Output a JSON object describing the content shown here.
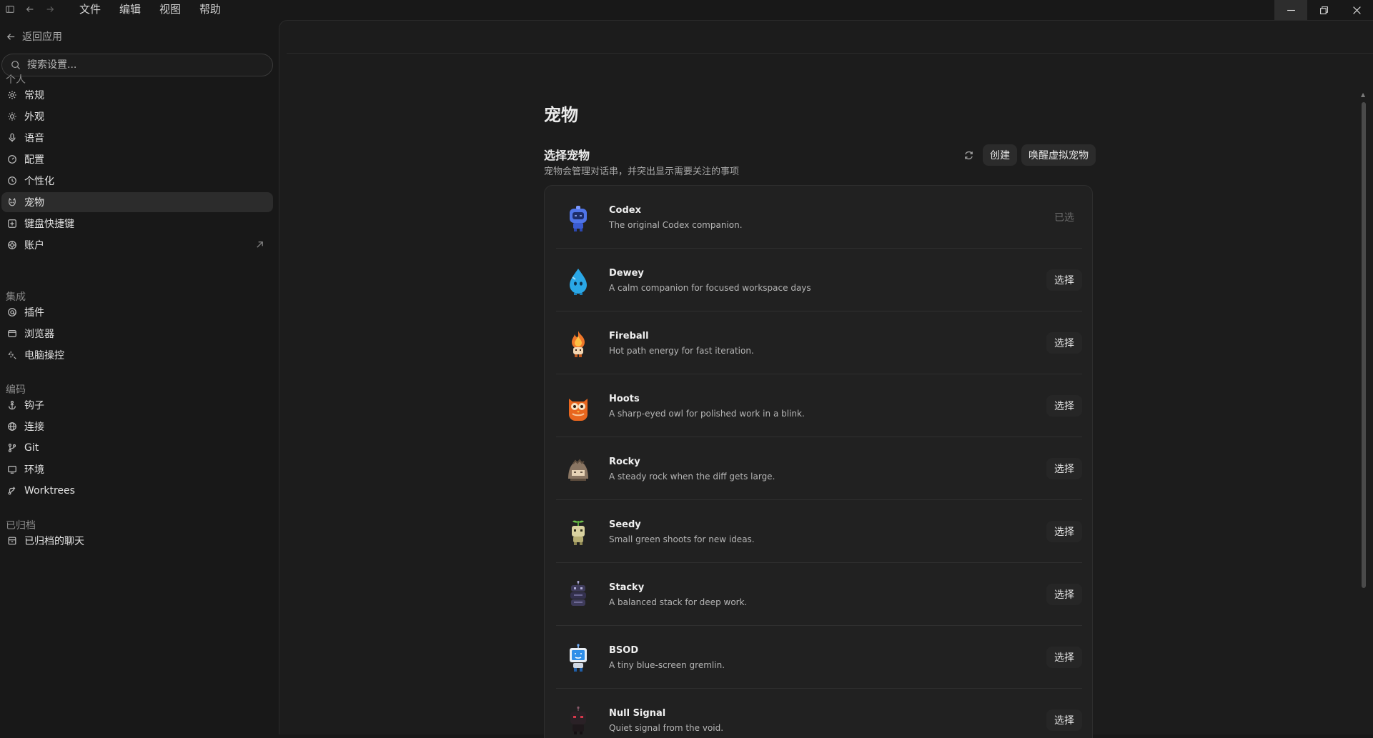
{
  "titlebar": {
    "menu": [
      "文件",
      "编辑",
      "视图",
      "帮助"
    ]
  },
  "sidebar": {
    "back_label": "返回应用",
    "search_placeholder": "搜索设置...",
    "sections": {
      "personal": "个人",
      "integrations": "集成",
      "coding": "编码",
      "archived": "已归档"
    },
    "personal_items": [
      {
        "label": "常规",
        "icon": "gear-icon"
      },
      {
        "label": "外观",
        "icon": "sun-icon"
      },
      {
        "label": "语音",
        "icon": "mic-icon"
      },
      {
        "label": "配置",
        "icon": "gauge-icon"
      },
      {
        "label": "个性化",
        "icon": "palette-icon"
      },
      {
        "label": "宠物",
        "icon": "pet-icon"
      },
      {
        "label": "键盘快捷键",
        "icon": "keyboard-icon"
      },
      {
        "label": "账户",
        "icon": "account-icon"
      }
    ],
    "integration_items": [
      {
        "label": "插件",
        "icon": "plugin-icon"
      },
      {
        "label": "浏览器",
        "icon": "browser-icon"
      },
      {
        "label": "电脑操控",
        "icon": "sparkle-icon"
      }
    ],
    "coding_items": [
      {
        "label": "钩子",
        "icon": "anchor-icon"
      },
      {
        "label": "连接",
        "icon": "globe-icon"
      },
      {
        "label": "Git",
        "icon": "git-branch-icon"
      },
      {
        "label": "环境",
        "icon": "monitor-icon"
      },
      {
        "label": "Worktrees",
        "icon": "worktree-icon"
      }
    ],
    "archived_items": [
      {
        "label": "已归档的聊天",
        "icon": "archive-icon"
      }
    ],
    "active_item": "宠物"
  },
  "main": {
    "page_title": "宠物",
    "section_title": "选择宠物",
    "section_subtitle": "宠物会管理对话串，并突出显示需要关注的事项",
    "create_label": "创建",
    "wake_label": "唤醒虚拟宠物",
    "pets": [
      {
        "name": "Codex",
        "desc": "The original Codex companion.",
        "button": "已选",
        "selected": true,
        "color": "#4f74e8"
      },
      {
        "name": "Dewey",
        "desc": "A calm companion for focused workspace days",
        "button": "选择",
        "selected": false,
        "color": "#2aa7e6"
      },
      {
        "name": "Fireball",
        "desc": "Hot path energy for fast iteration.",
        "button": "选择",
        "selected": false,
        "color": "#f0772a"
      },
      {
        "name": "Hoots",
        "desc": "A sharp-eyed owl for polished work in a blink.",
        "button": "选择",
        "selected": false,
        "color": "#e8661e"
      },
      {
        "name": "Rocky",
        "desc": "A steady rock when the diff gets large.",
        "button": "选择",
        "selected": false,
        "color": "#8a7663"
      },
      {
        "name": "Seedy",
        "desc": "Small green shoots for new ideas.",
        "button": "选择",
        "selected": false,
        "color": "#c7c08a"
      },
      {
        "name": "Stacky",
        "desc": "A balanced stack for deep work.",
        "button": "选择",
        "selected": false,
        "color": "#3e3b5a"
      },
      {
        "name": "BSOD",
        "desc": "A tiny blue-screen gremlin.",
        "button": "选择",
        "selected": false,
        "color": "#2f8ee8"
      },
      {
        "name": "Null Signal",
        "desc": "Quiet signal from the void.",
        "button": "选择",
        "selected": false,
        "color": "#3a2630"
      }
    ]
  }
}
